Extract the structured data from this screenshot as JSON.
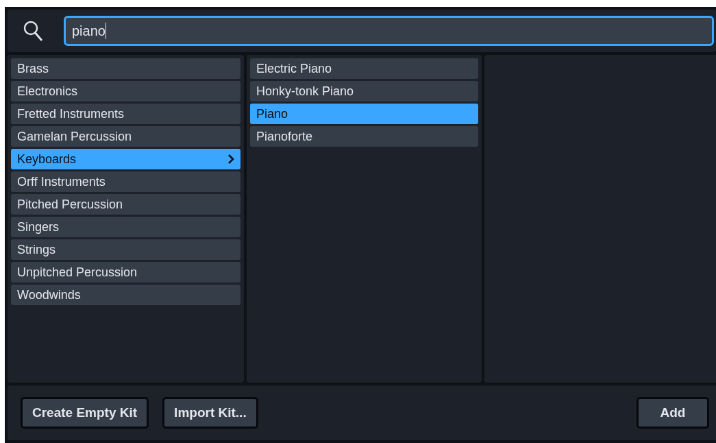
{
  "search": {
    "value": "piano"
  },
  "categories": [
    {
      "label": "Brass",
      "selected": false
    },
    {
      "label": "Electronics",
      "selected": false
    },
    {
      "label": "Fretted Instruments",
      "selected": false
    },
    {
      "label": "Gamelan Percussion",
      "selected": false
    },
    {
      "label": "Keyboards",
      "selected": true
    },
    {
      "label": "Orff Instruments",
      "selected": false
    },
    {
      "label": "Pitched Percussion",
      "selected": false
    },
    {
      "label": "Singers",
      "selected": false
    },
    {
      "label": "Strings",
      "selected": false
    },
    {
      "label": "Unpitched Percussion",
      "selected": false
    },
    {
      "label": "Woodwinds",
      "selected": false
    }
  ],
  "instruments": [
    {
      "label": "Electric Piano",
      "selected": false
    },
    {
      "label": "Honky-tonk Piano",
      "selected": false
    },
    {
      "label": "Piano",
      "selected": true
    },
    {
      "label": "Pianoforte",
      "selected": false
    }
  ],
  "buttons_left": [
    "Create Empty Kit",
    "Import Kit..."
  ],
  "buttons_right": [
    "Add"
  ]
}
